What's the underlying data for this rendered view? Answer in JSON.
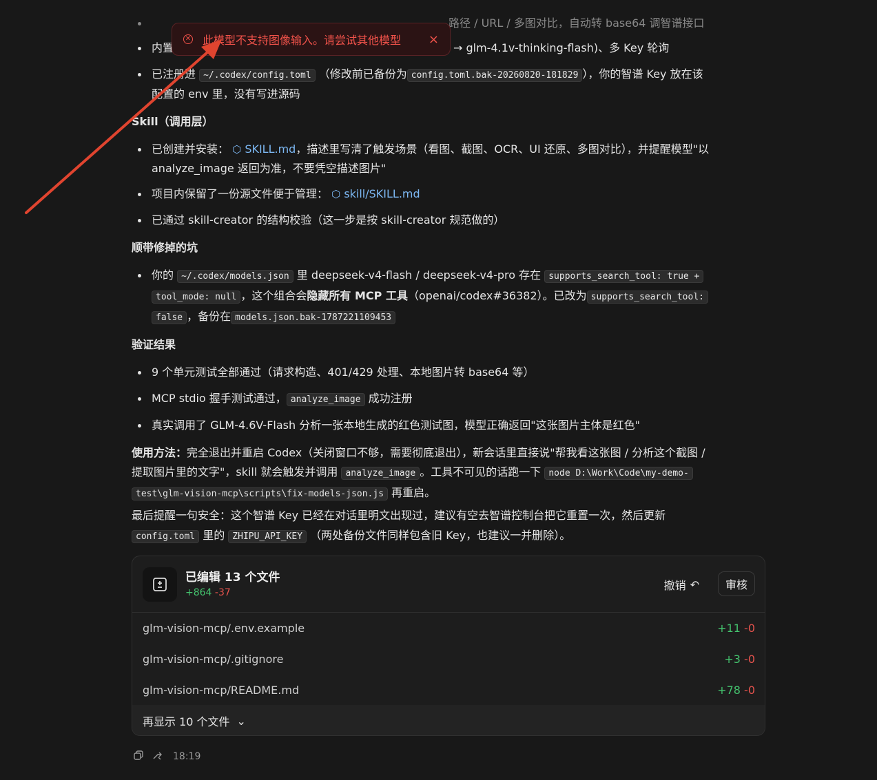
{
  "colors": {
    "background": "#181818",
    "text": "#e4e4e4",
    "link": "#7cb7f2",
    "error": "#f0524a",
    "additions": "#44c36e",
    "deletions": "#e6534d"
  },
  "top_cut_text": "路径 / URL / 多图对比，自动转 base64 调智谱接口",
  "bullet_builtin": {
    "prefix": "内置",
    "suffix": "→ glm-4.1v-thinking-flash)、多 Key 轮询"
  },
  "bullet_registered": {
    "pre": "已注册进",
    "code1": "~/.codex/config.toml",
    "mid": "（修改前已备份为",
    "code2": "config.toml.bak-20260820-181829",
    "post": "），你的智谱 Key 放在该",
    "line2": "配置的 env 里，没有写进源码"
  },
  "skill_heading": "Skill（调用层）",
  "skill_b1": {
    "pre": "已创建并安装：",
    "link": "SKILL.md",
    "post": "，描述里写清了触发场景（看图、截图、OCR、UI 还原、多图对比），并提醒模型\"以",
    "line2": "analyze_image 返回为准，不要凭空描述图片\""
  },
  "skill_b2": {
    "pre": "项目内保留了一份源文件便于管理：",
    "link": "skill/SKILL.md"
  },
  "skill_b3": "已通过 skill-creator 的结构校验（这一步是按 skill-creator 规范做的）",
  "fix_heading": "顺带修掉的坑",
  "fix_b1": {
    "pre": "你的",
    "code1": "~/.codex/models.json",
    "mid": "里 deepseek-v4-flash / deepseek-v4-pro 存在",
    "code2": "supports_search_tool: true +",
    "code3": "tool_mode: null",
    "mid2": "，这个组合会",
    "bold": "隐藏所有 MCP 工具",
    "mid3": "（openai/codex#36382）。已改为",
    "code4": "supports_search_tool:",
    "code5": "false",
    "mid4": "，备份在",
    "code6": "models.json.bak-1787221109453"
  },
  "verify_heading": "验证结果",
  "verify_b1": "9 个单元测试全部通过（请求构造、401/429 处理、本地图片转 base64 等）",
  "verify_b2": {
    "pre": "MCP stdio 握手测试通过，",
    "code": "analyze_image",
    "post": "成功注册"
  },
  "verify_b3": "真实调用了 GLM-4.6V-Flash 分析一张本地生成的红色测试图，模型正确返回\"这张图片主体是红色\"",
  "usage": {
    "bold": "使用方法：",
    "l1": "完全退出并重启 Codex（关闭窗口不够，需要彻底退出），新会话里直接说\"帮我看这张图 / 分析这个截图 /",
    "l2_pre": "提取图片里的文字\"，skill 就会触发并调用",
    "code1": "analyze_image",
    "l2_mid": "。工具不可见的话跑一下",
    "code2": "node D:\\Work\\Code\\my-demo-",
    "code3": "test\\glm-vision-mcp\\scripts\\fix-models-json.js",
    "l3_post": "再重启。"
  },
  "reminder": {
    "l1": "最后提醒一句安全：这个智谱 Key 已经在对话里明文出现过，建议有空去智谱控制台把它重置一次，然后更新",
    "code1": "config.toml",
    "mid": "里的",
    "code2": "ZHIPU_API_KEY",
    "post": "（两处备份文件同样包含旧 Key，也建议一并删除）。"
  },
  "toast": {
    "message": "此模型不支持图像输入。请尝试其他模型",
    "close": "×",
    "icon": "error-circle-icon"
  },
  "card": {
    "title": "已编辑 13 个文件",
    "additions": "+864",
    "deletions": "-37",
    "undo": "撤销",
    "review": "审核",
    "files": [
      {
        "name": "glm-vision-mcp/.env.example",
        "add": "+11",
        "del": "-0"
      },
      {
        "name": "glm-vision-mcp/.gitignore",
        "add": "+3",
        "del": "-0"
      },
      {
        "name": "glm-vision-mcp/README.md",
        "add": "+78",
        "del": "-0"
      }
    ],
    "show_more": "再显示 10 个文件"
  },
  "footer": {
    "time": "18:19"
  }
}
